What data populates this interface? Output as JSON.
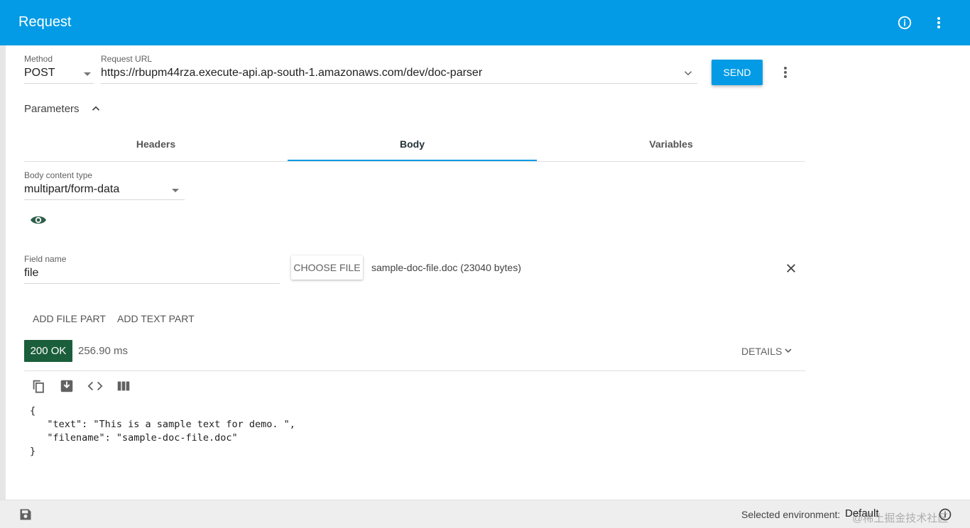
{
  "app": {
    "title": "Request"
  },
  "request": {
    "method_label": "Method",
    "method": "POST",
    "url_label": "Request URL",
    "url": "https://rbupm44rza.execute-api.ap-south-1.amazonaws.com/dev/doc-parser",
    "send_label": "SEND"
  },
  "parameters": {
    "label": "Parameters",
    "tabs": [
      {
        "label": "Headers"
      },
      {
        "label": "Body"
      },
      {
        "label": "Variables"
      }
    ],
    "active_tab": "Body"
  },
  "body": {
    "content_type_label": "Body content type",
    "content_type": "multipart/form-data",
    "field_name_label": "Field name",
    "field_name": "file",
    "choose_file_label": "CHOOSE FILE",
    "file_info": "sample-doc-file.doc (23040 bytes)",
    "add_file_part_label": "ADD FILE PART",
    "add_text_part_label": "ADD TEXT PART"
  },
  "response": {
    "status": "200 OK",
    "time": "256.90 ms",
    "details_label": "DETAILS",
    "code_lines": [
      "{",
      "   \"text\": \"This is a sample text for demo. \",",
      "   \"filename\": \"sample-doc-file.doc\"",
      "}"
    ]
  },
  "footer": {
    "env_label": "Selected environment:",
    "env_value": "Default",
    "watermark": "@稀土掘金技术社区"
  },
  "icons": [
    "info-icon",
    "more-vert-icon",
    "chevron-down-icon",
    "chevron-up-icon",
    "eye-icon",
    "close-icon",
    "copy-icon",
    "save-response-icon",
    "code-icon",
    "columns-icon",
    "save-icon",
    "help-icon"
  ],
  "colors": {
    "accent": "#039be5",
    "status_ok": "#1b5e3b"
  }
}
